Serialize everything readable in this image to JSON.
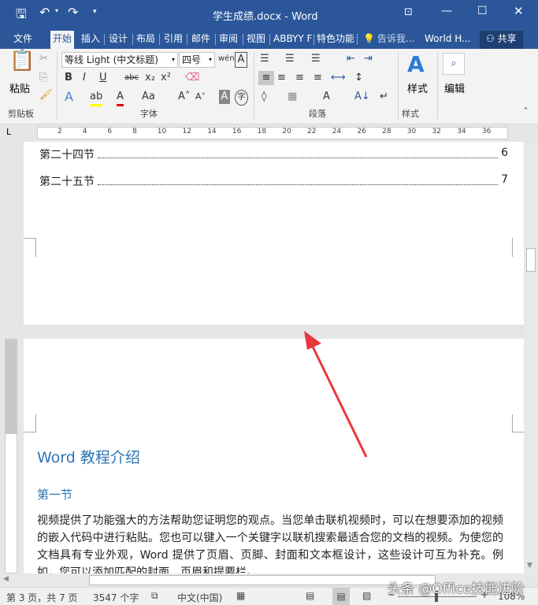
{
  "titlebar": {
    "title": "学生成绩.docx - Word"
  },
  "tabs": [
    "文件",
    "开始",
    "插入",
    "设计",
    "布局",
    "引用",
    "邮件",
    "审阅",
    "视图",
    "ABBYY F",
    "特色功能"
  ],
  "tell_me": "告诉我...",
  "account": "World H...",
  "share": "共享",
  "ribbon": {
    "paste": "粘贴",
    "clipboard": "剪贴板",
    "font_name": "等线 Light (中文标题)",
    "font_size": "四号",
    "font_group": "字体",
    "paragraph_group": "段落",
    "styles": "样式",
    "styles_group": "样式",
    "editing": "编辑"
  },
  "ruler_ticks": [
    "2",
    "4",
    "6",
    "8",
    "10",
    "12",
    "14",
    "16",
    "18",
    "20",
    "22",
    "24",
    "26",
    "28",
    "30",
    "32",
    "34",
    "36"
  ],
  "toc": [
    {
      "label": "第二十四节",
      "page": "6"
    },
    {
      "label": "第二十五节",
      "page": "7"
    }
  ],
  "doc": {
    "heading1": "Word 教程介绍",
    "heading2": "第一节",
    "paragraph": "视频提供了功能强大的方法帮助您证明您的观点。当您单击联机视频时，可以在想要添加的视频的嵌入代码中进行粘贴。您也可以键入一个关键字以联机搜索最适合您的文档的视频。为使您的文档具有专业外观，Word 提供了页眉、页脚、封面和文本框设计，这些设计可互为补充。例如，您可以添加匹配的封面、页眉和提要栏。"
  },
  "status": {
    "page": "第 3 页，共 7 页",
    "words": "3547 个字",
    "language": "中文(中国)",
    "zoom": "108%"
  },
  "watermark": "头条 @Office技能进阶",
  "colors": {
    "brand": "#2b579a",
    "heading": "#2e74b5",
    "arrow": "#e8383d"
  }
}
